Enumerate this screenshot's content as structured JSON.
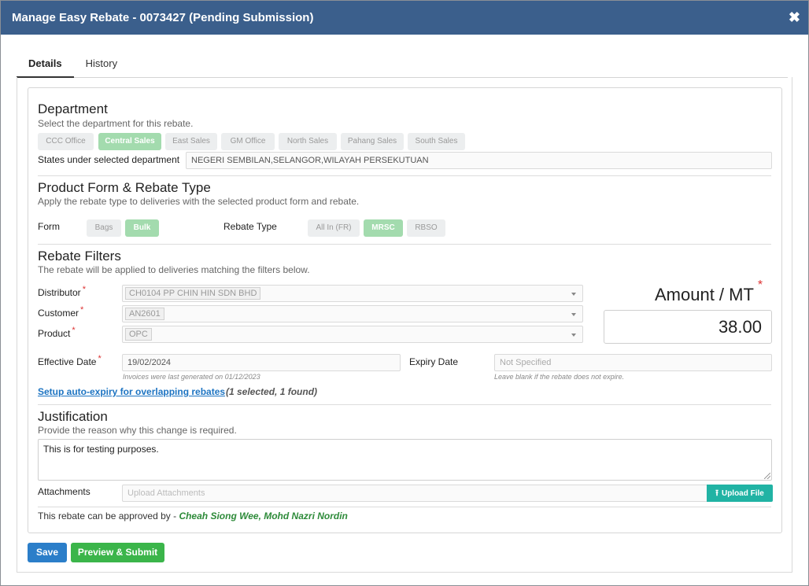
{
  "window": {
    "title": "Manage Easy Rebate - 0073427 (Pending Submission)",
    "close": "✖"
  },
  "tabs": [
    "Details",
    "History"
  ],
  "department": {
    "heading": "Department",
    "subtitle": "Select the department for this rebate.",
    "options": [
      "CCC Office",
      "Central Sales",
      "East Sales",
      "GM Office",
      "North Sales",
      "Pahang Sales",
      "South Sales"
    ],
    "selected": "Central Sales",
    "states_label": "States under selected department",
    "states_value": "NEGERI SEMBILAN,SELANGOR,WILAYAH PERSEKUTUAN"
  },
  "product": {
    "heading": "Product Form & Rebate Type",
    "subtitle": "Apply the rebate type to deliveries with the selected product form and rebate.",
    "form_label": "Form",
    "forms": [
      "Bags",
      "Bulk"
    ],
    "form_selected": "Bulk",
    "type_label": "Rebate Type",
    "types": [
      "All In (FR)",
      "MRSC",
      "RBSO"
    ],
    "type_selected": "MRSC"
  },
  "filters": {
    "heading": "Rebate Filters",
    "subtitle": "The rebate will be applied to deliveries matching the filters below.",
    "distributor_label": "Distributor",
    "distributor_value": "CH0104 PP CHIN HIN SDN BHD",
    "customer_label": "Customer",
    "customer_value": "AN2601",
    "product_label": "Product",
    "product_value": "OPC",
    "required_mark": "*",
    "amount_label": "Amount / MT",
    "amount_value": "38.00",
    "effective_label": "Effective Date",
    "effective_value": "19/02/2024",
    "effective_hint": "Invoices were last generated on 01/12/2023",
    "expiry_label": "Expiry Date",
    "expiry_placeholder": "Not Specified",
    "expiry_hint": "Leave blank if the rebate does not expire.",
    "auto_expiry_link": "Setup auto-expiry for overlapping rebates",
    "auto_expiry_note": "(1 selected, 1 found)"
  },
  "justification": {
    "heading": "Justification",
    "subtitle": "Provide the reason why this change is required.",
    "text": "This is for testing purposes.",
    "attachments_label": "Attachments",
    "attachments_placeholder": "Upload Attachments",
    "upload_label": "Upload File"
  },
  "approval": {
    "prefix": "This rebate can be approved by - ",
    "approvers": "Cheah Siong Wee, Mohd Nazri Nordin"
  },
  "actions": {
    "save": "Save",
    "preview_submit": "Preview & Submit"
  },
  "colors": {
    "titlebar": "#3b5f8c",
    "chip_selected": "#a3dbae",
    "save": "#2b7ec9",
    "submit": "#3bb54a",
    "upload": "#21b3a4",
    "approvers": "#2e8b3a",
    "link": "#1d74c2"
  }
}
